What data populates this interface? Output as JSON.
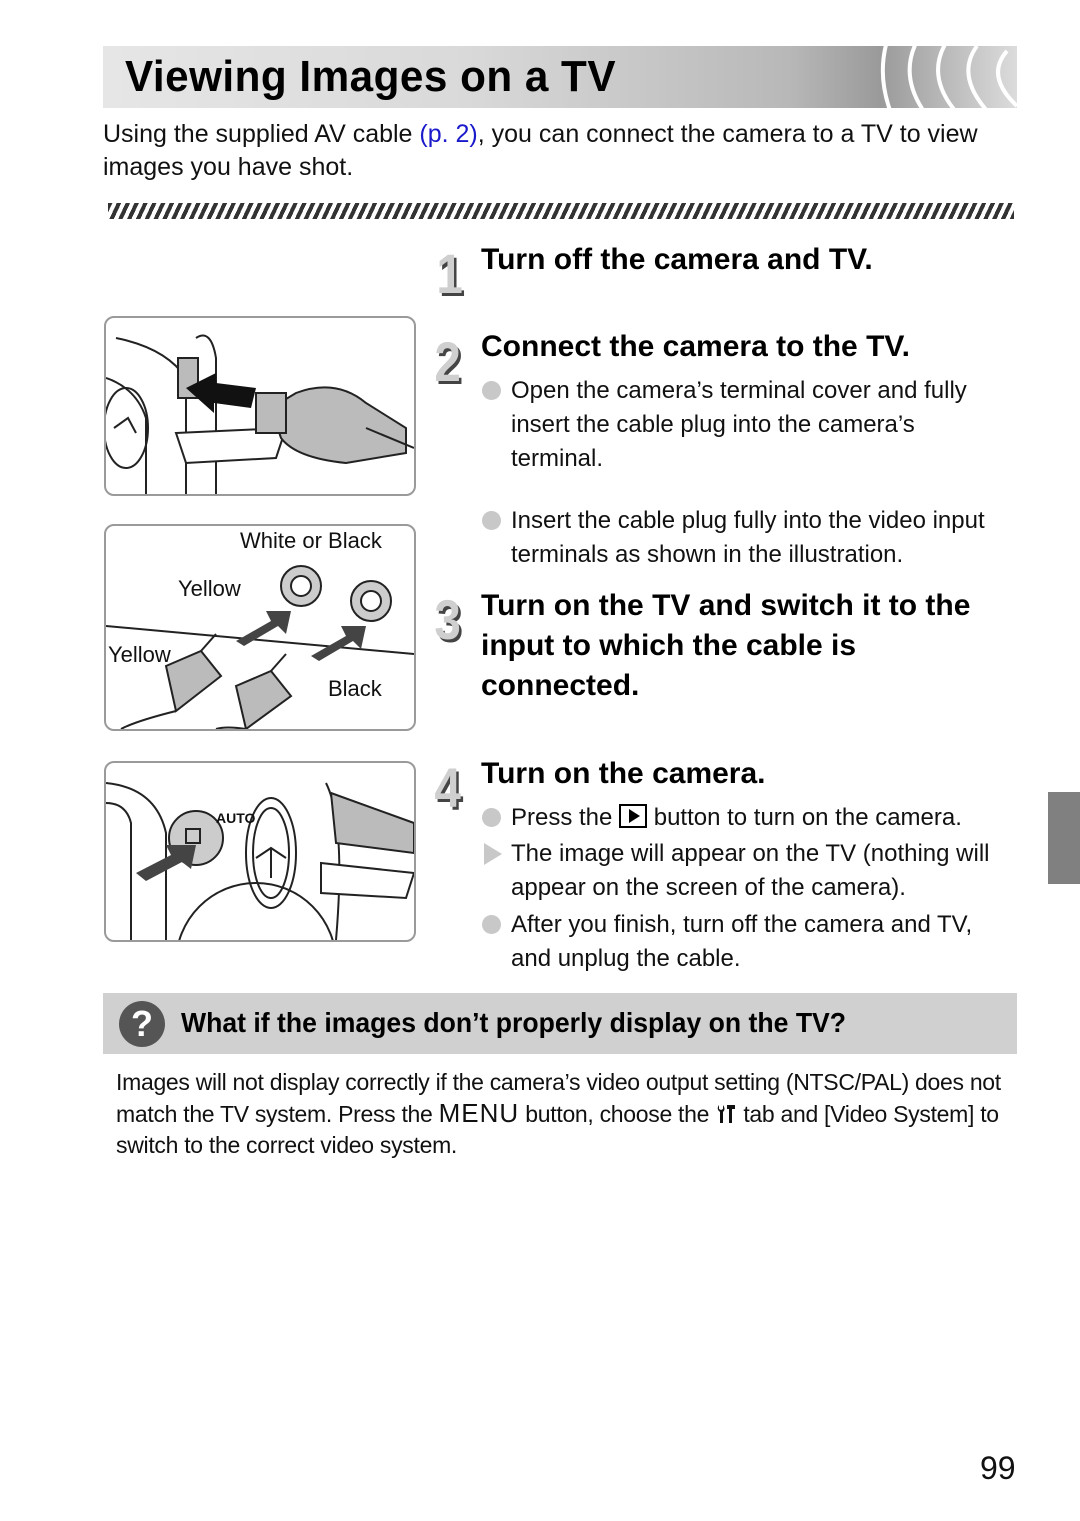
{
  "page": {
    "title": "Viewing Images on a TV",
    "intro": {
      "before_link": "Using the supplied AV cable ",
      "link": "(p. 2)",
      "after_link": ", you can connect the camera to a TV to view images you have shot."
    },
    "steps": [
      {
        "number": "1",
        "title": "Turn off the camera and TV.",
        "items": []
      },
      {
        "number": "2",
        "title": "Connect the camera to the TV.",
        "items": [
          {
            "type": "bullet",
            "text": "Open the camera’s terminal cover and fully insert the cable plug into the camera’s terminal."
          },
          {
            "type": "bullet",
            "text": "Insert the cable plug fully into the video input terminals as shown in the illustration."
          }
        ]
      },
      {
        "number": "3",
        "title": "Turn on the TV and switch it to the input to which the cable is connected.",
        "items": []
      },
      {
        "number": "4",
        "title": "Turn on the camera.",
        "items": [
          {
            "type": "bullet",
            "before_icon": "Press the ",
            "icon": "playback-button-icon",
            "after_icon": " button to turn on the camera."
          },
          {
            "type": "result",
            "text": "The image will appear on the TV (nothing will appear on the screen of the camera)."
          },
          {
            "type": "bullet",
            "text": "After you finish, turn off the camera and TV, and unplug the cable."
          }
        ]
      }
    ],
    "figures": {
      "connection_labels": {
        "white_or_black": "White or Black",
        "yellow_jack": "Yellow",
        "yellow_plug": "Yellow",
        "black_plug": "Black"
      }
    },
    "faq": {
      "icon": "question-icon",
      "title": "What if the images don’t properly display on the TV?",
      "body_1": "Images will not display correctly if the camera’s video output setting (NTSC/PAL) does not match the TV system. Press the ",
      "menu_word": "MENU",
      "body_2": " button, choose the ",
      "tab_icon": "tools-tab-icon",
      "body_3": " tab and [Video System] to switch to the correct video system."
    },
    "page_number": "99"
  }
}
